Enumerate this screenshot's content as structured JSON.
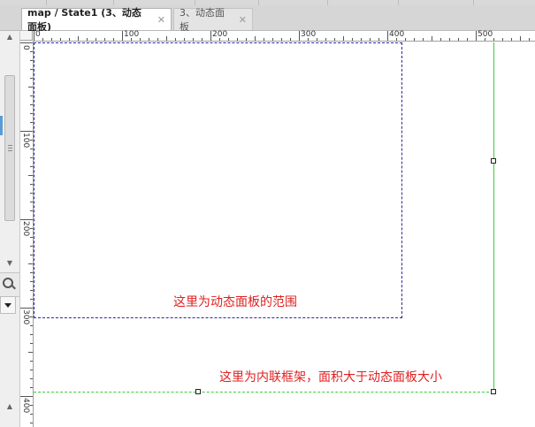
{
  "tabs": [
    {
      "label": "map / State1 (3、动态面板)",
      "active": true,
      "close": "✕"
    },
    {
      "label": "3、动态面板",
      "active": false,
      "close": "✕"
    }
  ],
  "ruler": {
    "horizontal": [
      "0",
      "100",
      "200",
      "300",
      "400",
      "500"
    ],
    "vertical": [
      "0",
      "100",
      "200",
      "300",
      "400"
    ]
  },
  "annotations": {
    "dynamic_panel_note": "这里为动态面板的范围",
    "inline_frame_note": "这里为内联框架，面积大于动态面板大小"
  },
  "colors": {
    "dynamic_panel_border": "#2a2a9a",
    "inline_frame_border": "#3dcc3d",
    "annotation_text": "#e02020"
  },
  "left_panel": {
    "scroll_up": "▲",
    "scroll_down": "▼"
  }
}
